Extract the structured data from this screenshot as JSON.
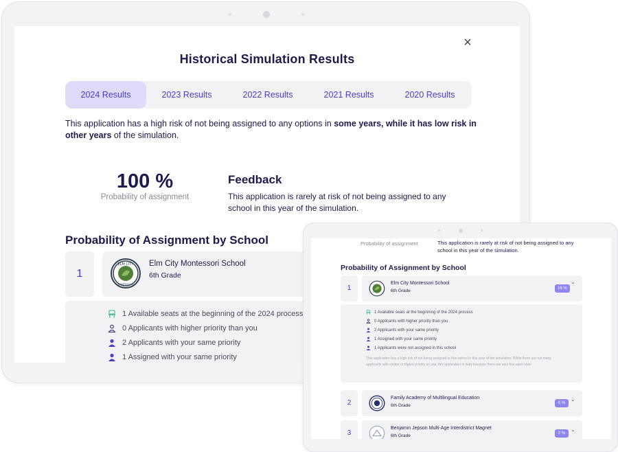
{
  "modal": {
    "title": "Historical Simulation Results",
    "close_glyph": "×",
    "tabs": [
      {
        "label": "2024 Results"
      },
      {
        "label": "2023 Results"
      },
      {
        "label": "2022 Results"
      },
      {
        "label": "2021 Results"
      },
      {
        "label": "2020 Results"
      }
    ],
    "active_tab": "2024 Results",
    "intro_plain_1": "This application has a high risk of not being assigned to any options in ",
    "intro_bold": "some years, while it has low risk in other years",
    "intro_plain_2": " of the simulation.",
    "probability_value": "100 %",
    "probability_label": "Probability of assignment",
    "feedback_title": "Feedback",
    "feedback_text": "This application is rarely at risk of not being assigned to any school in this year of the simulation.",
    "section_title": "Probability of Assignment by School"
  },
  "schools": [
    {
      "rank": "1",
      "name": "Elm City Montessori School",
      "grade": "6th Grade",
      "probability": "16 %"
    },
    {
      "rank": "2",
      "name": "Family Academy of Multilingual Education",
      "grade": "6th Grade",
      "probability": "0 %"
    },
    {
      "rank": "3",
      "name": "Benjamin Jepson Multi-Age Interdistrict Magnet",
      "grade": "6th Grade",
      "probability": "0 %"
    }
  ],
  "details": {
    "rows": [
      {
        "icon": "seat-icon",
        "text": "1 Available seats at the beginning of the 2024 process"
      },
      {
        "icon": "person-outline-icon",
        "text": "0 Applicants with higher priority than you"
      },
      {
        "icon": "person-icon",
        "text": "2 Applicants with your same priority"
      },
      {
        "icon": "person-icon",
        "text": "1 Assigned with your same priority"
      },
      {
        "icon": "person-icon",
        "text": "1 Applicants were not assigned in this school"
      }
    ],
    "note": "This application has a high risk of not being assigned to this school in this year of the simulation. While there are not many applicants with similar or higher priority as you, this application is risky because there are very few open slots"
  },
  "colors": {
    "accent": "#4b3fc8",
    "active_tab_bg": "#dedbfa",
    "badge": "#8f86ec",
    "seat_icon": "#5fbf9a"
  }
}
